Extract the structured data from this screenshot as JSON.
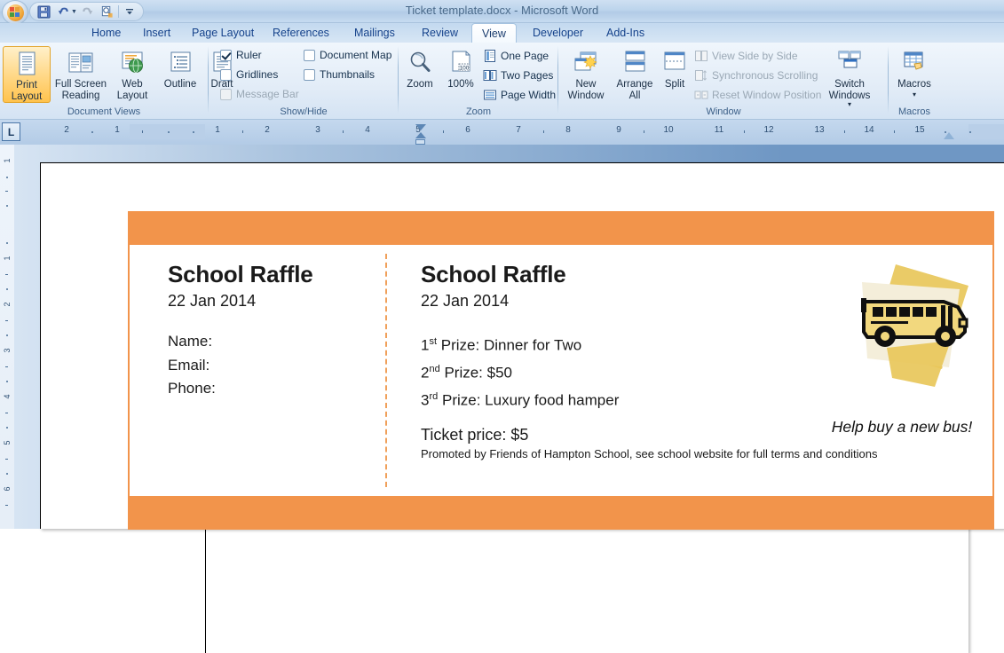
{
  "window": {
    "title": "Ticket template.docx - Microsoft Word",
    "orb_name": "office-button"
  },
  "quick_access": {
    "items": [
      {
        "name": "save-button",
        "label": "Save"
      },
      {
        "name": "undo-button",
        "label": "Undo"
      },
      {
        "name": "redo-button",
        "label": "Redo"
      },
      {
        "name": "print-preview-button",
        "label": "Print Preview"
      },
      {
        "name": "customize-quick-access-button",
        "label": "Customize Quick Access Toolbar"
      }
    ]
  },
  "tabs": [
    {
      "label": "Home",
      "active": false
    },
    {
      "label": "Insert",
      "active": false
    },
    {
      "label": "Page Layout",
      "active": false
    },
    {
      "label": "References",
      "active": false
    },
    {
      "label": "Mailings",
      "active": false
    },
    {
      "label": "Review",
      "active": false
    },
    {
      "label": "View",
      "active": true
    },
    {
      "label": "Developer",
      "active": false
    },
    {
      "label": "Add-Ins",
      "active": false
    }
  ],
  "ribbon": {
    "groups": {
      "document_views": {
        "label": "Document Views",
        "buttons": [
          {
            "label": "Print Layout",
            "selected": true
          },
          {
            "label": "Full Screen Reading",
            "selected": false
          },
          {
            "label": "Web Layout",
            "selected": false
          },
          {
            "label": "Outline",
            "selected": false
          },
          {
            "label": "Draft",
            "selected": false
          }
        ]
      },
      "show_hide": {
        "label": "Show/Hide",
        "checkboxes": [
          {
            "label": "Ruler",
            "checked": true,
            "disabled": false
          },
          {
            "label": "Gridlines",
            "checked": false,
            "disabled": false
          },
          {
            "label": "Message Bar",
            "checked": false,
            "disabled": true
          },
          {
            "label": "Document Map",
            "checked": false,
            "disabled": false
          },
          {
            "label": "Thumbnails",
            "checked": false,
            "disabled": false
          }
        ]
      },
      "zoom": {
        "label": "Zoom",
        "big_buttons": [
          {
            "label": "Zoom"
          },
          {
            "label": "100%"
          }
        ],
        "small_buttons": [
          {
            "label": "One Page",
            "disabled": false
          },
          {
            "label": "Two Pages",
            "disabled": false
          },
          {
            "label": "Page Width",
            "disabled": false
          }
        ]
      },
      "window": {
        "label": "Window",
        "big_buttons": [
          {
            "label": "New Window"
          },
          {
            "label": "Arrange All"
          },
          {
            "label": "Split"
          },
          {
            "label": "Switch Windows"
          }
        ],
        "small_buttons": [
          {
            "label": "View Side by Side",
            "disabled": true
          },
          {
            "label": "Synchronous Scrolling",
            "disabled": true
          },
          {
            "label": "Reset Window Position",
            "disabled": true
          }
        ]
      },
      "macros": {
        "label": "Macros",
        "buttons": [
          {
            "label": "Macros"
          }
        ]
      }
    }
  },
  "ruler": {
    "tab_selector": "L",
    "horizontal_numbers": [
      "2",
      "1",
      "1",
      "2",
      "3",
      "4",
      "5",
      "6",
      "7",
      "8",
      "9",
      "10",
      "11",
      "12",
      "13",
      "14",
      "15"
    ],
    "vertical_numbers": [
      "1",
      "1",
      "2",
      "3",
      "4",
      "5",
      "6"
    ]
  },
  "document": {
    "ticket": {
      "stub": {
        "title": "School Raffle",
        "date": "22 Jan 2014",
        "fields": [
          "Name:",
          "Email:",
          "Phone:"
        ]
      },
      "main": {
        "title": "School Raffle",
        "date": "22 Jan 2014",
        "prizes": [
          {
            "ordinal": "1",
            "suffix": "st",
            "text": "Prize: Dinner for Two"
          },
          {
            "ordinal": "2",
            "suffix": "nd",
            "text": "Prize: $50"
          },
          {
            "ordinal": "3",
            "suffix": "rd",
            "text": "Prize: Luxury food hamper"
          }
        ],
        "price": "Ticket price: $5",
        "terms": "Promoted by Friends of Hampton School, see school website for full terms and conditions"
      },
      "artwork": {
        "tagline": "Help buy a new bus!",
        "image_name": "school-bus-clipart"
      },
      "colors": {
        "band": "#f2944b",
        "perforation": "#f0a05a"
      }
    }
  }
}
